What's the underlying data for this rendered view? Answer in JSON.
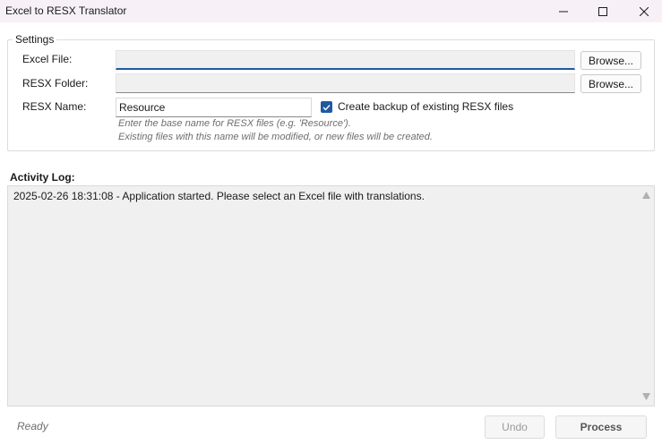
{
  "window": {
    "title": "Excel to RESX Translator"
  },
  "settings": {
    "group_title": "Settings",
    "excel_file": {
      "label": "Excel File:",
      "value": "",
      "browse_label": "Browse..."
    },
    "resx_folder": {
      "label": "RESX Folder:",
      "value": "",
      "browse_label": "Browse..."
    },
    "resx_name": {
      "label": "RESX Name:",
      "value": "Resource",
      "backup_checkbox_label": "Create backup of existing RESX files",
      "backup_checked": true
    },
    "hint_line1": "Enter the base name for RESX files (e.g. 'Resource').",
    "hint_line2": "Existing files with this name will be modified, or new files will be created."
  },
  "activity_log": {
    "label": "Activity Log:",
    "entries": [
      "2025-02-26 18:31:08 - Application started. Please select an Excel file with translations."
    ]
  },
  "statusbar": {
    "status_text": "Ready",
    "undo_label": "Undo",
    "undo_enabled": false,
    "process_label": "Process",
    "process_enabled": false
  },
  "colors": {
    "accent": "#1f5aa0",
    "titlebar_bg": "#f7f1f7",
    "field_bg": "#f0f0f0",
    "disabled_text": "#9a9a9a",
    "hint_text": "#6e6e6e"
  },
  "icons": {
    "minimize": "minimize-icon",
    "maximize": "maximize-icon",
    "close": "close-icon",
    "checkbox": "checkmark-icon",
    "scroll_up": "scroll-up-arrow-icon",
    "scroll_down": "scroll-down-arrow-icon"
  }
}
